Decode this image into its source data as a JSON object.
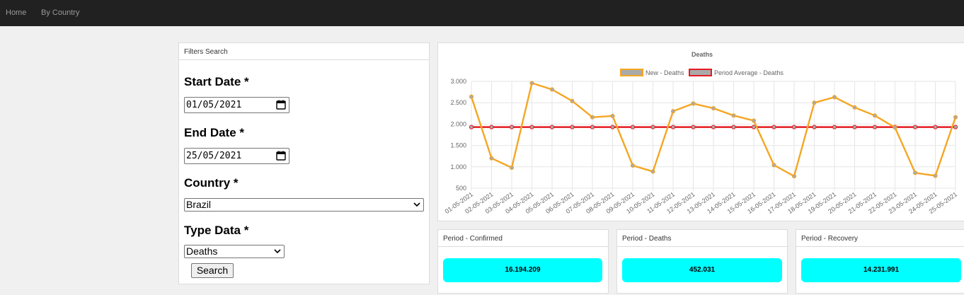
{
  "nav": {
    "home": "Home",
    "by_country": "By Country"
  },
  "filters": {
    "header": "Filters Search",
    "start_label": "Start Date *",
    "start_value": "01/05/2021",
    "end_label": "End Date *",
    "end_value": "25/05/2021",
    "country_label": "Country *",
    "country_value": "Brazil",
    "type_label": "Type Data *",
    "type_value": "Deaths",
    "search_button": "Search"
  },
  "chart_data": {
    "type": "line",
    "title": "Deaths",
    "categories": [
      "01-05-2021",
      "02-05-2021",
      "03-05-2021",
      "04-05-2021",
      "05-05-2021",
      "06-05-2021",
      "07-05-2021",
      "08-05-2021",
      "09-05-2021",
      "10-05-2021",
      "11-05-2021",
      "12-05-2021",
      "13-05-2021",
      "14-05-2021",
      "15-05-2021",
      "16-05-2021",
      "17-05-2021",
      "18-05-2021",
      "19-05-2021",
      "20-05-2021",
      "21-05-2021",
      "22-05-2021",
      "23-05-2021",
      "24-05-2021",
      "25-05-2021"
    ],
    "series": [
      {
        "name": "New - Deaths",
        "color": "#f5a623",
        "values": [
          2640,
          1200,
          980,
          2960,
          2810,
          2540,
          2160,
          2190,
          1030,
          890,
          2300,
          2480,
          2370,
          2200,
          2080,
          1040,
          780,
          2500,
          2630,
          2390,
          2200,
          1920,
          860,
          790,
          2160
        ]
      },
      {
        "name": "Period Average - Deaths",
        "color": "#e51c23",
        "values": [
          1930,
          1930,
          1930,
          1930,
          1930,
          1930,
          1930,
          1930,
          1930,
          1930,
          1930,
          1930,
          1930,
          1930,
          1930,
          1930,
          1930,
          1930,
          1930,
          1930,
          1930,
          1930,
          1930,
          1930,
          1930
        ]
      }
    ],
    "yticks": [
      "3.000",
      "2.500",
      "2.000",
      "1.500",
      "1.000",
      "500"
    ],
    "ylim": [
      500,
      3000
    ],
    "grid": true,
    "legend": "top"
  },
  "stats": [
    {
      "title": "Period - Confirmed",
      "value": "16.194.209"
    },
    {
      "title": "Period - Deaths",
      "value": "452.031"
    },
    {
      "title": "Period - Recovery",
      "value": "14.231.991"
    }
  ],
  "colors": {
    "navbar": "#212121",
    "stat_box": "#00ffff"
  }
}
